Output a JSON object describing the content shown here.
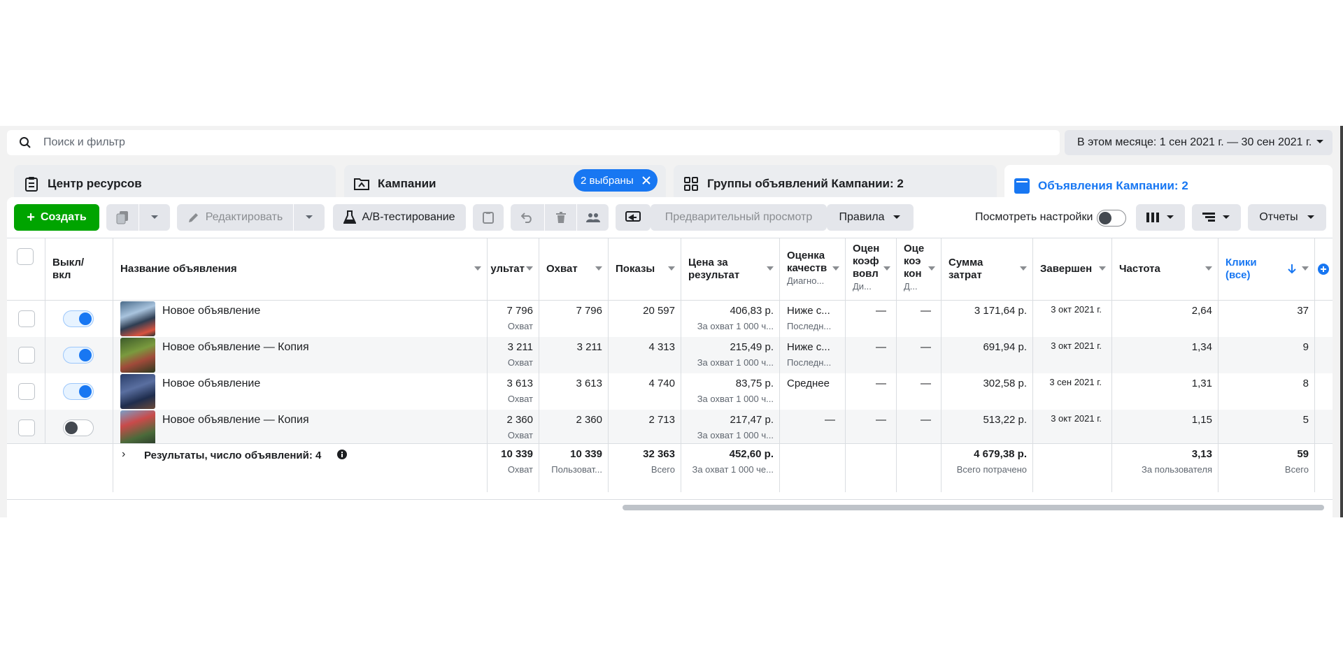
{
  "search": {
    "placeholder": "Поиск и фильтр"
  },
  "date_range": "В этом месяце: 1 сен 2021 г. — 30 сен 2021 г.",
  "tabs": {
    "resources": "Центр ресурсов",
    "campaigns": "Кампании",
    "campaigns_selected": "2 выбраны",
    "adsets": "Группы объявлений Кампании: 2",
    "ads": "Объявления Кампании: 2"
  },
  "toolbar": {
    "create": "Создать",
    "edit": "Редактировать",
    "ab_test": "A/B-тестирование",
    "preview": "Предварительный просмотр",
    "rules": "Правила",
    "view_settings": "Посмотреть настройки",
    "reports": "Отчеты"
  },
  "columns": {
    "toggle": "Выкл/ вкл",
    "name": "Название объявления",
    "results": "ультат",
    "reach": "Охват",
    "impressions": "Показы",
    "cost_per_result": "Цена за результат",
    "quality": "Оценка качеств",
    "quality_sub": "Диагно...",
    "engagement": "Оцен коэф вовл",
    "engagement_sub": "Ди...",
    "conversion": "Оце коэ кон",
    "conversion_sub": "Д...",
    "amount_spent": "Сумма затрат",
    "ends": "Завершен",
    "frequency": "Частота",
    "clicks": "Клики (все)"
  },
  "rows": [
    {
      "name": "Новое объявление",
      "active": true,
      "results": "7 796",
      "results_sub": "Охват",
      "reach": "7 796",
      "impressions": "20 597",
      "cpr": "406,83 р.",
      "cpr_sub": "За охват 1 000 ч...",
      "quality": "Ниже с...",
      "quality_sub": "Последн...",
      "engagement": "—",
      "conversion": "—",
      "spent": "3 171,64 р.",
      "ends": "3 окт 2021 г.",
      "frequency": "2,64",
      "clicks": "37"
    },
    {
      "name": "Новое объявление — Копия",
      "active": true,
      "results": "3 211",
      "results_sub": "Охват",
      "reach": "3 211",
      "impressions": "4 313",
      "cpr": "215,49 р.",
      "cpr_sub": "За охват 1 000 ч...",
      "quality": "Ниже с...",
      "quality_sub": "Последн...",
      "engagement": "—",
      "conversion": "—",
      "spent": "691,94 р.",
      "ends": "3 окт 2021 г.",
      "frequency": "1,34",
      "clicks": "9"
    },
    {
      "name": "Новое объявление",
      "active": true,
      "results": "3 613",
      "results_sub": "Охват",
      "reach": "3 613",
      "impressions": "4 740",
      "cpr": "83,75 р.",
      "cpr_sub": "За охват 1 000 ч...",
      "quality": "Среднее",
      "quality_sub": "",
      "engagement": "—",
      "conversion": "—",
      "spent": "302,58 р.",
      "ends": "3 сен 2021 г.",
      "frequency": "1,31",
      "clicks": "8"
    },
    {
      "name": "Новое объявление — Копия",
      "active": false,
      "results": "2 360",
      "results_sub": "Охват",
      "reach": "2 360",
      "impressions": "2 713",
      "cpr": "217,47 р.",
      "cpr_sub": "За охват 1 000 ч...",
      "quality": "—",
      "quality_sub": "",
      "engagement": "—",
      "conversion": "—",
      "spent": "513,22 р.",
      "ends": "3 окт 2021 г.",
      "frequency": "1,15",
      "clicks": "5"
    }
  ],
  "totals": {
    "label": "Результаты, число объявлений: 4",
    "results": "10 339",
    "results_sub": "Охват",
    "reach": "10 339",
    "reach_sub": "Пользоват...",
    "impressions": "32 363",
    "impressions_sub": "Всего",
    "cpr": "452,60 р.",
    "cpr_sub": "За охват 1 000 че...",
    "spent": "4 679,38 р.",
    "spent_sub": "Всего потрачено",
    "frequency": "3,13",
    "frequency_sub": "За пользователя",
    "clicks": "59",
    "clicks_sub": "Всего"
  },
  "colors": {
    "accent": "#1877f2",
    "create": "#00a400"
  }
}
